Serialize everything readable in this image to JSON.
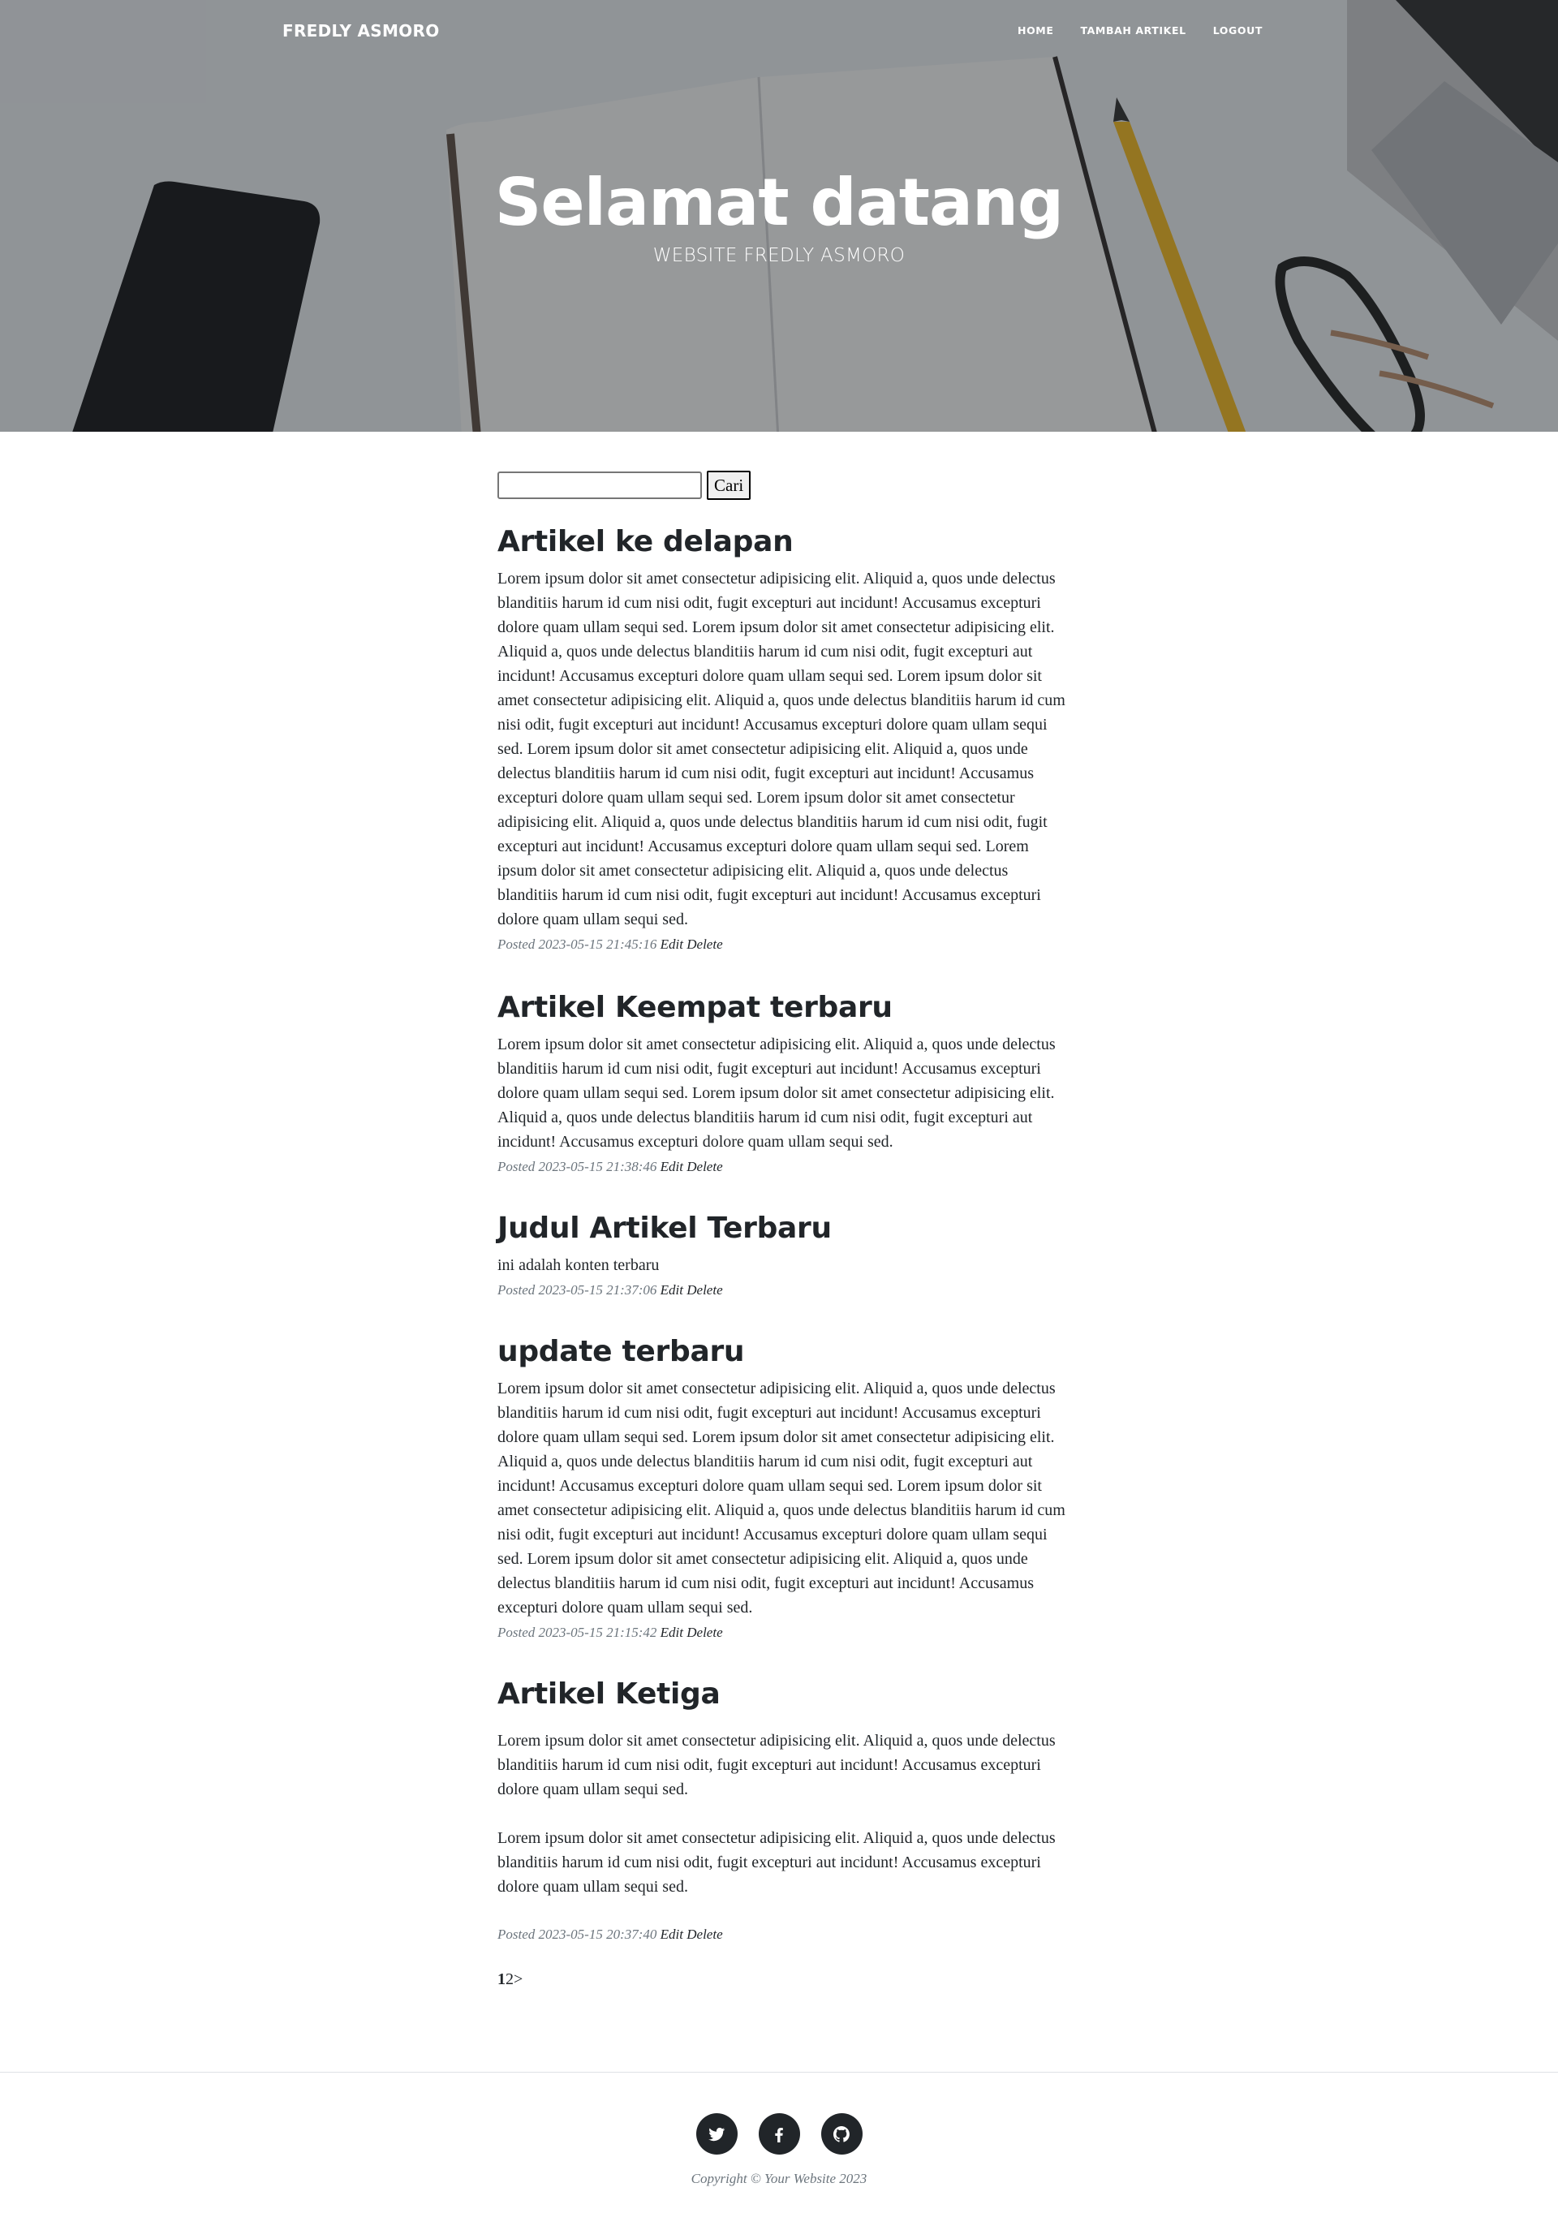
{
  "navbar": {
    "brand": "FREDLY ASMORO",
    "links": [
      "HOME",
      "TAMBAH ARTIKEL",
      "LOGOUT"
    ]
  },
  "hero": {
    "title": "Selamat datang",
    "subtitle": "WEBSITE FREDLY ASMORO"
  },
  "search": {
    "value": "",
    "button_label": "Cari"
  },
  "articles": [
    {
      "title": "Artikel ke delapan",
      "paragraphs": [
        "Lorem ipsum dolor sit amet consectetur adipisicing elit. Aliquid a, quos unde delectus blanditiis harum id cum nisi odit, fugit excepturi aut incidunt! Accusamus excepturi dolore quam ullam sequi sed. Lorem ipsum dolor sit amet consectetur adipisicing elit. Aliquid a, quos unde delectus blanditiis harum id cum nisi odit, fugit excepturi aut incidunt! Accusamus excepturi dolore quam ullam sequi sed. Lorem ipsum dolor sit amet consectetur adipisicing elit. Aliquid a, quos unde delectus blanditiis harum id cum nisi odit, fugit excepturi aut incidunt! Accusamus excepturi dolore quam ullam sequi sed. Lorem ipsum dolor sit amet consectetur adipisicing elit. Aliquid a, quos unde delectus blanditiis harum id cum nisi odit, fugit excepturi aut incidunt! Accusamus excepturi dolore quam ullam sequi sed. Lorem ipsum dolor sit amet consectetur adipisicing elit. Aliquid a, quos unde delectus blanditiis harum id cum nisi odit, fugit excepturi aut incidunt! Accusamus excepturi dolore quam ullam sequi sed. Lorem ipsum dolor sit amet consectetur adipisicing elit. Aliquid a, quos unde delectus blanditiis harum id cum nisi odit, fugit excepturi aut incidunt! Accusamus excepturi dolore quam ullam sequi sed."
      ],
      "posted": "Posted 2023-05-15 21:45:16",
      "edit": "Edit",
      "delete": "Delete"
    },
    {
      "title": "Artikel Keempat terbaru",
      "paragraphs": [
        "Lorem ipsum dolor sit amet consectetur adipisicing elit. Aliquid a, quos unde delectus blanditiis harum id cum nisi odit, fugit excepturi aut incidunt! Accusamus excepturi dolore quam ullam sequi sed. Lorem ipsum dolor sit amet consectetur adipisicing elit. Aliquid a, quos unde delectus blanditiis harum id cum nisi odit, fugit excepturi aut incidunt! Accusamus excepturi dolore quam ullam sequi sed."
      ],
      "posted": "Posted 2023-05-15 21:38:46",
      "edit": "Edit",
      "delete": "Delete"
    },
    {
      "title": "Judul Artikel Terbaru",
      "paragraphs": [
        "ini adalah konten terbaru"
      ],
      "posted": "Posted 2023-05-15 21:37:06",
      "edit": "Edit",
      "delete": "Delete"
    },
    {
      "title": "update terbaru",
      "paragraphs": [
        "Lorem ipsum dolor sit amet consectetur adipisicing elit. Aliquid a, quos unde delectus blanditiis harum id cum nisi odit, fugit excepturi aut incidunt! Accusamus excepturi dolore quam ullam sequi sed. Lorem ipsum dolor sit amet consectetur adipisicing elit. Aliquid a, quos unde delectus blanditiis harum id cum nisi odit, fugit excepturi aut incidunt! Accusamus excepturi dolore quam ullam sequi sed. Lorem ipsum dolor sit amet consectetur adipisicing elit. Aliquid a, quos unde delectus blanditiis harum id cum nisi odit, fugit excepturi aut incidunt! Accusamus excepturi dolore quam ullam sequi sed. Lorem ipsum dolor sit amet consectetur adipisicing elit. Aliquid a, quos unde delectus blanditiis harum id cum nisi odit, fugit excepturi aut incidunt! Accusamus excepturi dolore quam ullam sequi sed."
      ],
      "posted": "Posted 2023-05-15 21:15:42",
      "edit": "Edit",
      "delete": "Delete"
    },
    {
      "title": "Artikel Ketiga",
      "paragraphs": [
        "Lorem ipsum dolor sit amet consectetur adipisicing elit. Aliquid a, quos unde delectus blanditiis harum id cum nisi odit, fugit excepturi aut incidunt! Accusamus excepturi dolore quam ullam sequi sed.",
        "Lorem ipsum dolor sit amet consectetur adipisicing elit. Aliquid a, quos unde delectus blanditiis harum id cum nisi odit, fugit excepturi aut incidunt! Accusamus excepturi dolore quam ullam sequi sed."
      ],
      "posted": "Posted 2023-05-15 20:37:40",
      "edit": "Edit",
      "delete": "Delete"
    }
  ],
  "pagination": {
    "pages": [
      "1",
      "2"
    ],
    "next": ">"
  },
  "footer": {
    "icons": [
      "twitter-icon",
      "facebook-icon",
      "github-icon"
    ],
    "copyright": "Copyright © Your Website 2023"
  },
  "colors": {
    "text": "#212529",
    "muted": "#6c757d",
    "overlay": "rgba(33,37,41,0.45)"
  }
}
